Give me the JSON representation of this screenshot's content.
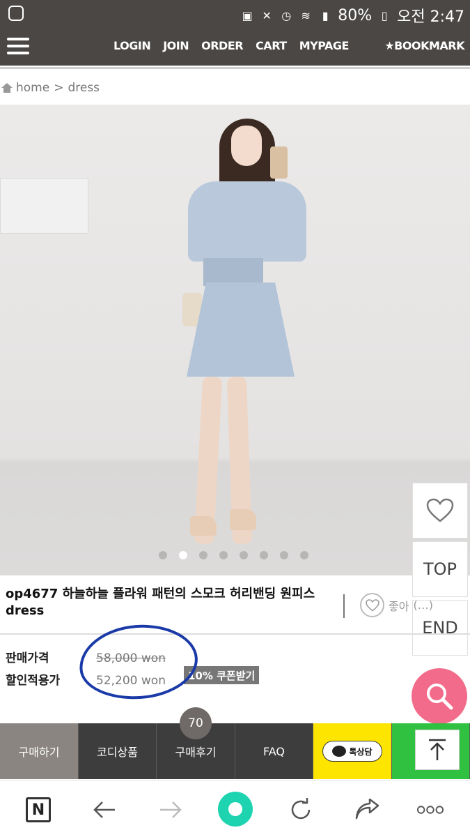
{
  "status_bar": {
    "battery": "80%",
    "time": "오전 2:47"
  },
  "nav": {
    "links": [
      "LOGIN",
      "JOIN",
      "ORDER",
      "CART",
      "MYPAGE"
    ],
    "bookmark": "★BOOKMARK"
  },
  "breadcrumb": {
    "home": "home",
    "separator": ">",
    "current": "dress"
  },
  "gallery": {
    "slide_count": 8,
    "active_slide": 2
  },
  "side_buttons": {
    "top": "TOP",
    "end": "END"
  },
  "product": {
    "title_line1": "op4677 하늘하늘 플라워 패턴의 스모크 허리밴딩 원피스",
    "title_line2": "dress",
    "like_label": "좋아",
    "like_count": "(…)",
    "price_label": "판매가격",
    "discount_label": "할인적용가",
    "price": "58,000 won",
    "discount_price": "52,200 won",
    "coupon": "10% 쿠폰받기"
  },
  "tabs": {
    "buy": "구매하기",
    "coordi": "코디상품",
    "reviews": "구매후기",
    "reviews_count": "70",
    "faq": "FAQ",
    "kakao": "톡상담"
  },
  "colors": {
    "header_bg": "#4a4745",
    "accent_pink": "#f26b8a",
    "kakao_yellow": "#fee500",
    "line_green": "#2fc13f",
    "home_teal": "#1dd3b0",
    "ink_blue": "#1a3aa8"
  }
}
